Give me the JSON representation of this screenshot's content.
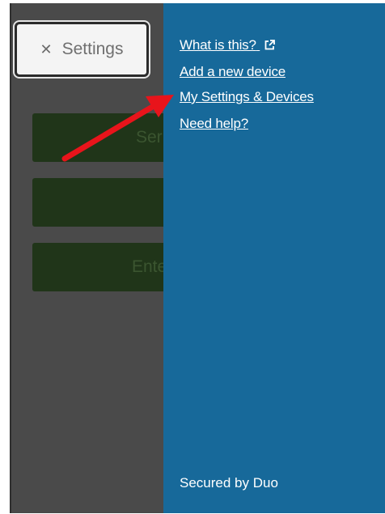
{
  "settings_button": {
    "icon": "close-icon",
    "label": "Settings"
  },
  "background_buttons": [
    {
      "partial_label": "Ser"
    },
    {
      "partial_label": ""
    },
    {
      "partial_label": "Ente"
    }
  ],
  "menu": {
    "what_is_this": "What is this?",
    "add_device": "Add a new device",
    "my_settings": "My Settings & Devices",
    "need_help": "Need help?"
  },
  "footer": {
    "secured_by": "Secured by Duo"
  },
  "colors": {
    "panel_blue": "#17699a",
    "overlay_gray": "#4a4a4a",
    "dim_green": "#203519",
    "annotation_red": "#e8141b"
  }
}
